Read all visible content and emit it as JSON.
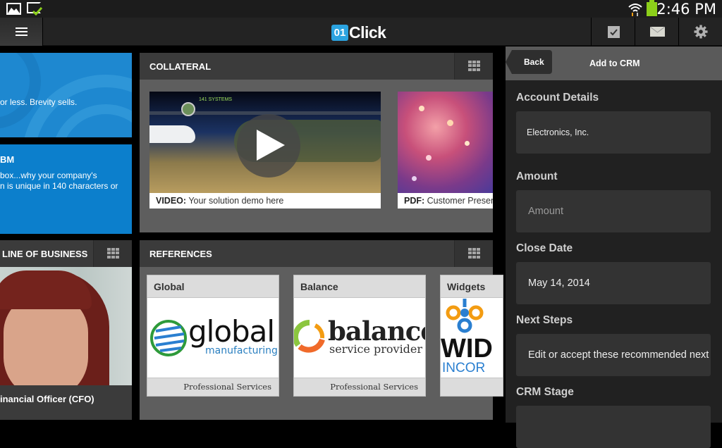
{
  "status_bar": {
    "time": "2:46 PM",
    "icons": [
      "gallery-icon",
      "sync-check-icon",
      "wifi-icon",
      "battery-icon"
    ],
    "battery_color": "#8ccf1a"
  },
  "app_bar": {
    "logo_badge": "01",
    "logo_word": "Click",
    "logo_color": "#2ba3e0",
    "actions": [
      "checkbox-icon",
      "mail-icon",
      "gear-icon"
    ]
  },
  "left_tiles": {
    "tile1_text": "or less. Brevity sells.",
    "tile2_title": "BM",
    "tile2_line1": "box...why your company's",
    "tile2_line2": "n is unique in 140 characters or",
    "lob_title": "LINE OF BUSINESS",
    "lob_caption": "inancial Officer (CFO)"
  },
  "collateral": {
    "title": "COLLATERAL",
    "items": [
      {
        "type": "VIDEO:",
        "label": "Your solution demo here",
        "thumb_text": "141 SYSTEMS"
      },
      {
        "type": "PDF:",
        "label": "Customer Presentation"
      }
    ]
  },
  "references": {
    "title": "REFERENCES",
    "cards": [
      {
        "name": "Global",
        "logo_main": "global",
        "logo_sub": "manufacturing",
        "category": "Professional Services"
      },
      {
        "name": "Balance",
        "logo_main": "balance",
        "logo_sub": "service provider",
        "category": "Professional Services"
      },
      {
        "name": "Widgets",
        "logo_main": "WID",
        "logo_sub": "INCOR",
        "category": ""
      }
    ]
  },
  "crm": {
    "back_label": "Back",
    "title": "Add to CRM",
    "fields": [
      {
        "label": "Account Details",
        "value": "Electronics, Inc.",
        "placeholder": ""
      },
      {
        "label": "Amount",
        "value": "",
        "placeholder": "Amount"
      },
      {
        "label": "Close Date",
        "value": "May 14, 2014",
        "placeholder": ""
      },
      {
        "label": "Next Steps",
        "value": "Edit or accept these recommended next steps",
        "placeholder": ""
      },
      {
        "label": "CRM Stage",
        "value": "",
        "placeholder": ""
      }
    ]
  }
}
